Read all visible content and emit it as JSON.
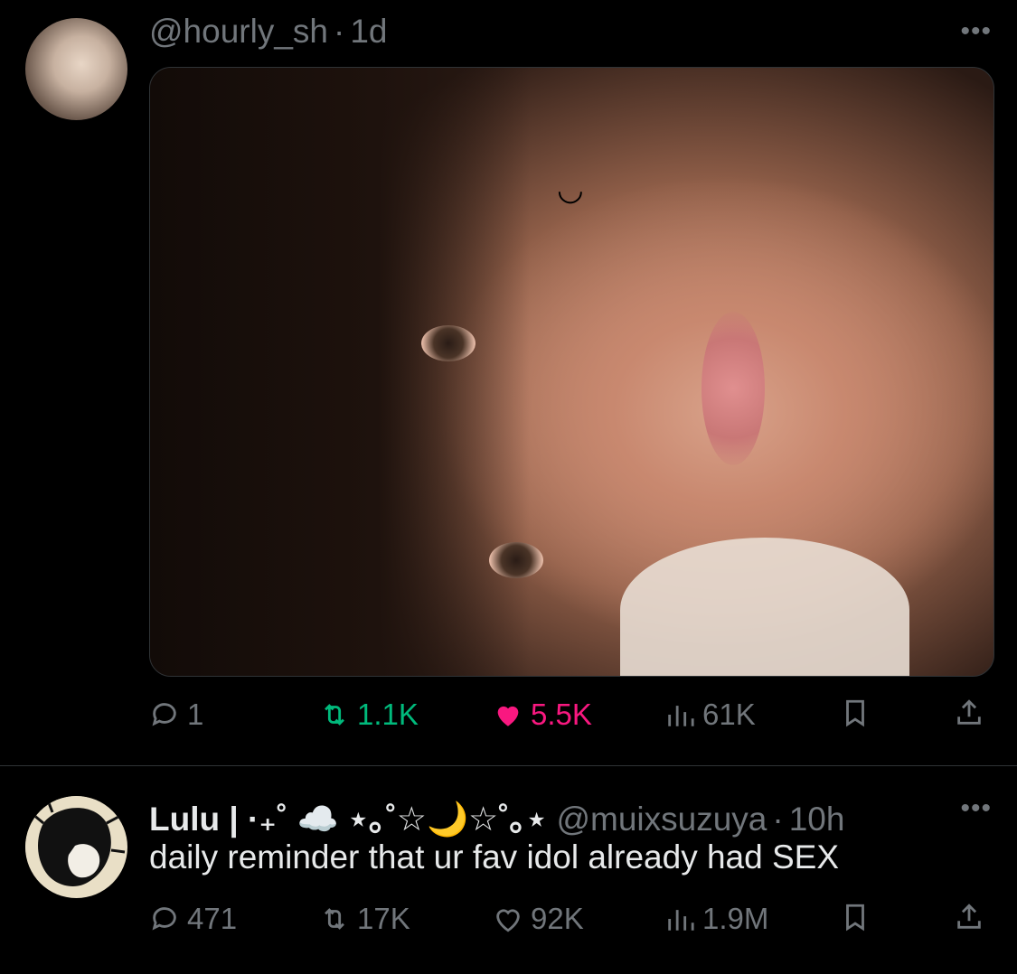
{
  "tweets": [
    {
      "handle": "@hourly_sh",
      "separator": "·",
      "time": "1d",
      "more_label": "•••",
      "media_mark": "◡",
      "actions": {
        "reply_count": "1",
        "retweet_count": "1.1K",
        "like_count": "5.5K",
        "views_count": "61K"
      },
      "retweeted": true,
      "liked": true
    },
    {
      "display_name": "Lulu | ·₊˚ ☁️ ⋆｡˚☆🌙☆˚｡⋆",
      "handle": "@muixsuzuya",
      "separator": "·",
      "time": "10h",
      "more_label": "•••",
      "text": "daily reminder that ur fav idol already had SEX",
      "actions": {
        "reply_count": "471",
        "retweet_count": "17K",
        "like_count": "92K",
        "views_count": "1.9M"
      },
      "retweeted": false,
      "liked": false
    }
  ],
  "colors": {
    "background": "#000000",
    "text_primary": "#e7e9ea",
    "text_secondary": "#71767b",
    "retweet_active": "#00ba7c",
    "like_active": "#f91880",
    "divider": "#2f3336"
  },
  "icons": [
    "reply-icon",
    "retweet-icon",
    "like-icon",
    "views-icon",
    "bookmark-icon",
    "share-icon",
    "more-icon"
  ]
}
